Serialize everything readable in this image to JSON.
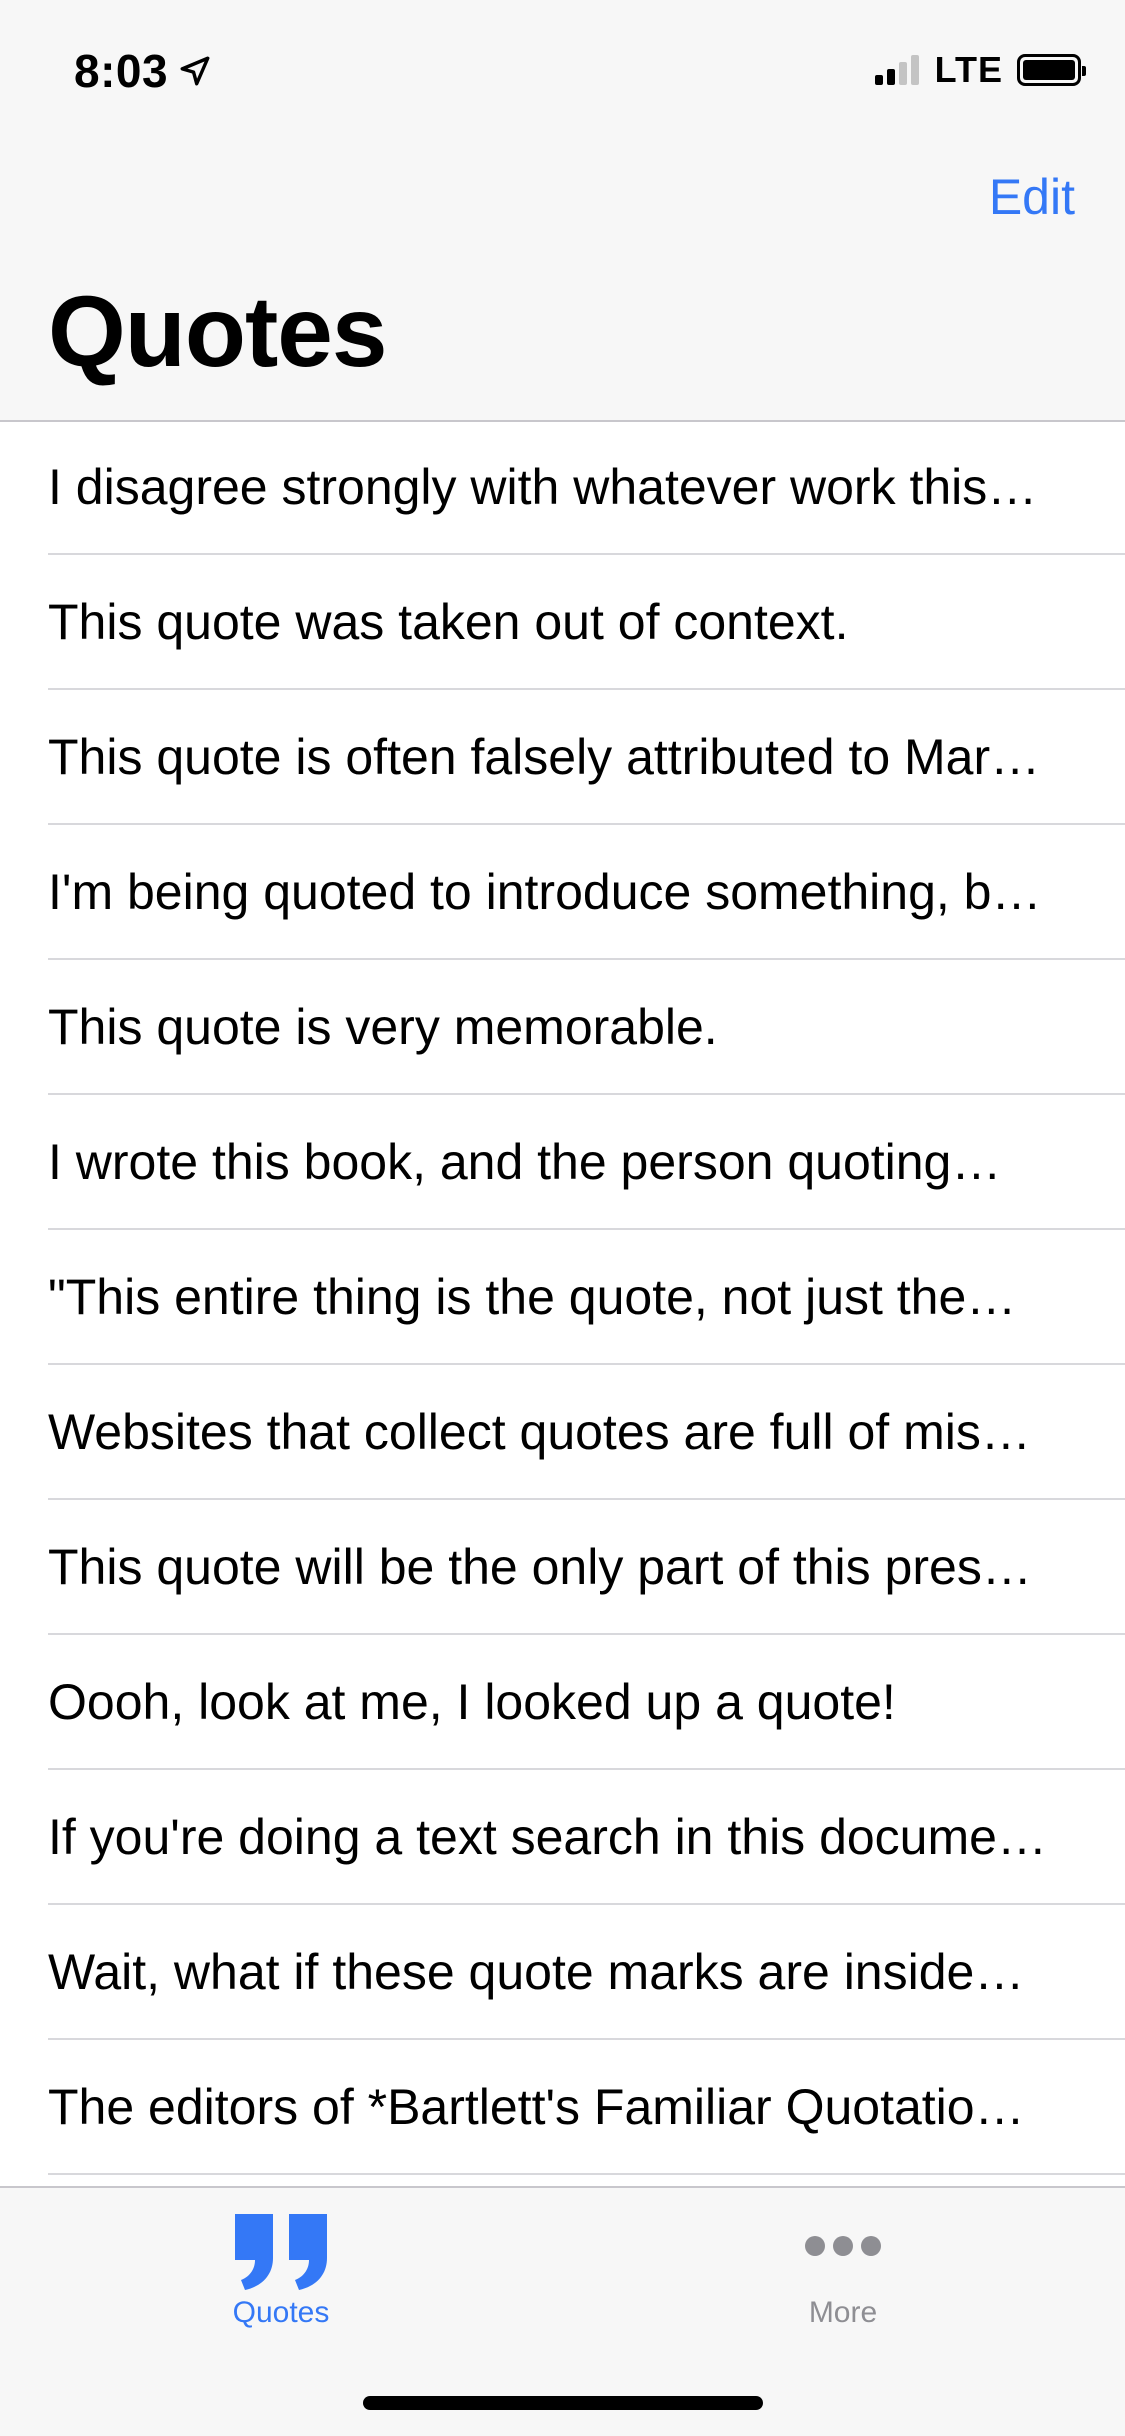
{
  "status_bar": {
    "time": "8:03",
    "network": "LTE",
    "icons": [
      "location-arrow-icon",
      "cellular-signal-icon",
      "battery-icon"
    ]
  },
  "nav": {
    "title": "Quotes",
    "edit_label": "Edit"
  },
  "quotes": [
    "I disagree strongly with whatever work this…",
    "This quote was taken out of context.",
    "This quote is often falsely attributed to Mar…",
    "I'm being quoted to introduce something, b…",
    "This quote is very memorable.",
    "I wrote this book, and the person quoting…",
    "\"This entire thing is the quote, not just the…",
    "Websites that collect quotes are full of mis…",
    "This quote will be the only part of this pres…",
    "Oooh, look at me, I looked up a quote!",
    "If you're doing a text search in this docume…",
    "Wait, what if these quote marks are inside…",
    "The editors of *Bartlett's Familiar Quotatio…"
  ],
  "tab_bar": {
    "tabs": [
      {
        "label": "Quotes",
        "icon": "quote-marks-icon",
        "selected": true
      },
      {
        "label": "More",
        "icon": "more-dots-icon",
        "selected": false
      }
    ]
  },
  "colors": {
    "accent": "#3478f6",
    "inactive": "#8e8e93",
    "separator": "#d8d8dc",
    "bar_background": "#f7f7f7"
  }
}
